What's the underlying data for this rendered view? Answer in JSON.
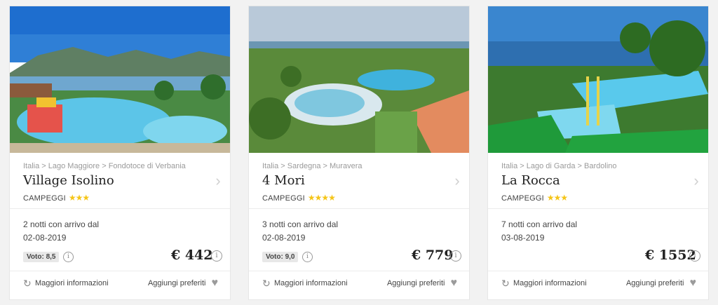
{
  "cards": [
    {
      "breadcrumb": "Italia > Lago Maggiore > Fondotoce di Verbania",
      "title": "Village Isolino",
      "category": "CAMPEGGI",
      "stars": "★★★",
      "star_count": 3,
      "nights": "2 notti con arrivo dal",
      "date": "02-08-2019",
      "vote": "Voto: 8,5",
      "price": "€ 442",
      "more_label": "Maggiori informazioni",
      "fav_label": "Aggiungi preferiti"
    },
    {
      "breadcrumb": "Italia > Sardegna > Muravera",
      "title": "4 Mori",
      "category": "CAMPEGGI",
      "stars": "★★★★",
      "star_count": 4,
      "nights": "3 notti con arrivo dal",
      "date": "02-08-2019",
      "vote": "Voto: 9,0",
      "price": "€ 779",
      "more_label": "Maggiori informazioni",
      "fav_label": "Aggiungi preferiti"
    },
    {
      "breadcrumb": "Italia > Lago di Garda > Bardolino",
      "title": "La Rocca",
      "category": "CAMPEGGI",
      "stars": "★★★",
      "star_count": 3,
      "nights": "7 notti con arrivo dal",
      "date": "03-08-2019",
      "price": "€ 1552",
      "more_label": "Maggiori informazioni",
      "fav_label": "Aggiungi preferiti"
    }
  ],
  "icons": {
    "info": "info-icon",
    "chevron": "chevron-right-icon",
    "refresh": "refresh-icon",
    "heart": "heart-icon"
  },
  "colors": {
    "star": "#f5c518",
    "heart": "#9b9b9b"
  }
}
